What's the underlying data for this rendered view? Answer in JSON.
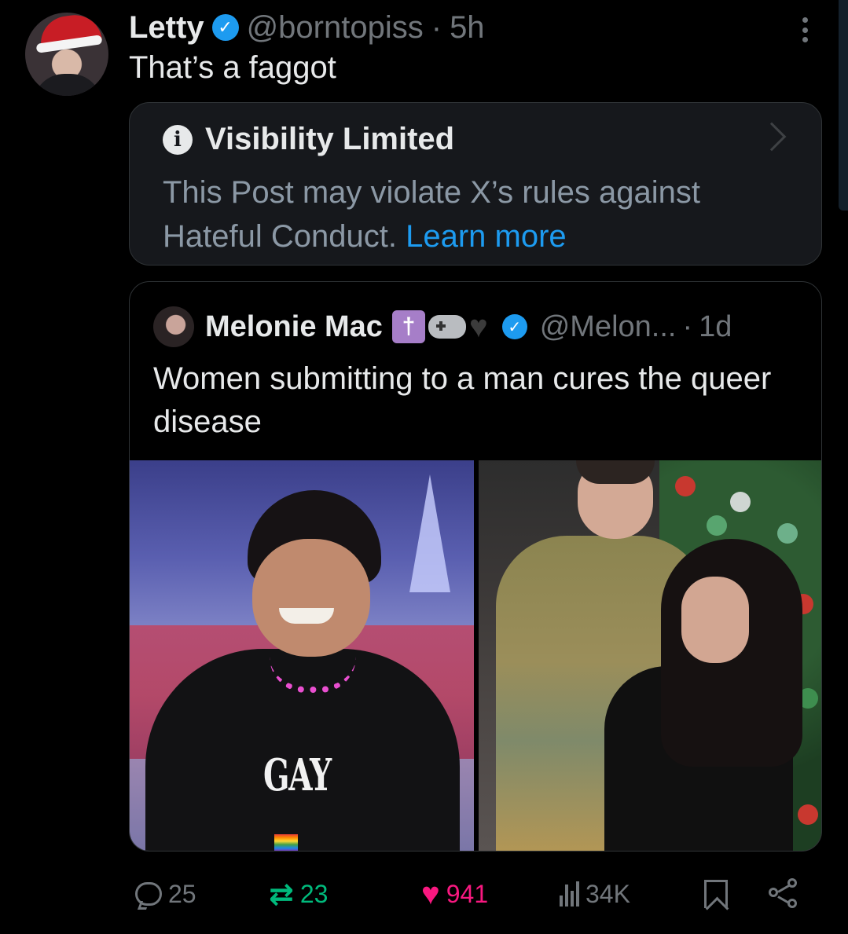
{
  "post": {
    "author_name": "Letty",
    "author_handle": "@borntopiss",
    "separator": "·",
    "time": "5h",
    "text": "That’s a faggot"
  },
  "notice": {
    "title": "Visibility Limited",
    "body": "This Post may violate X’s rules against Hateful Conduct.",
    "link": "Learn more"
  },
  "quoted": {
    "author_name": "Melonie Mac",
    "emoji": [
      "✝️",
      "🎮",
      "🖤"
    ],
    "author_handle": "@Melon...",
    "separator": "·",
    "time": "1d",
    "text": "Women submitting to a man cures the queer disease",
    "image_left_shirt_text": "GAY"
  },
  "actions": {
    "replies": "25",
    "reposts": "23",
    "likes": "941",
    "views": "34K"
  },
  "colors": {
    "background": "#000000",
    "accent": "#1d9bf0",
    "repost": "#00ba7c",
    "like": "#f91880",
    "muted": "#71767b"
  },
  "icons": [
    "verified-badge-icon",
    "more-icon",
    "info-icon",
    "chevron-right-icon",
    "reply-icon",
    "repost-icon",
    "like-icon",
    "views-icon",
    "bookmark-icon",
    "share-icon"
  ]
}
